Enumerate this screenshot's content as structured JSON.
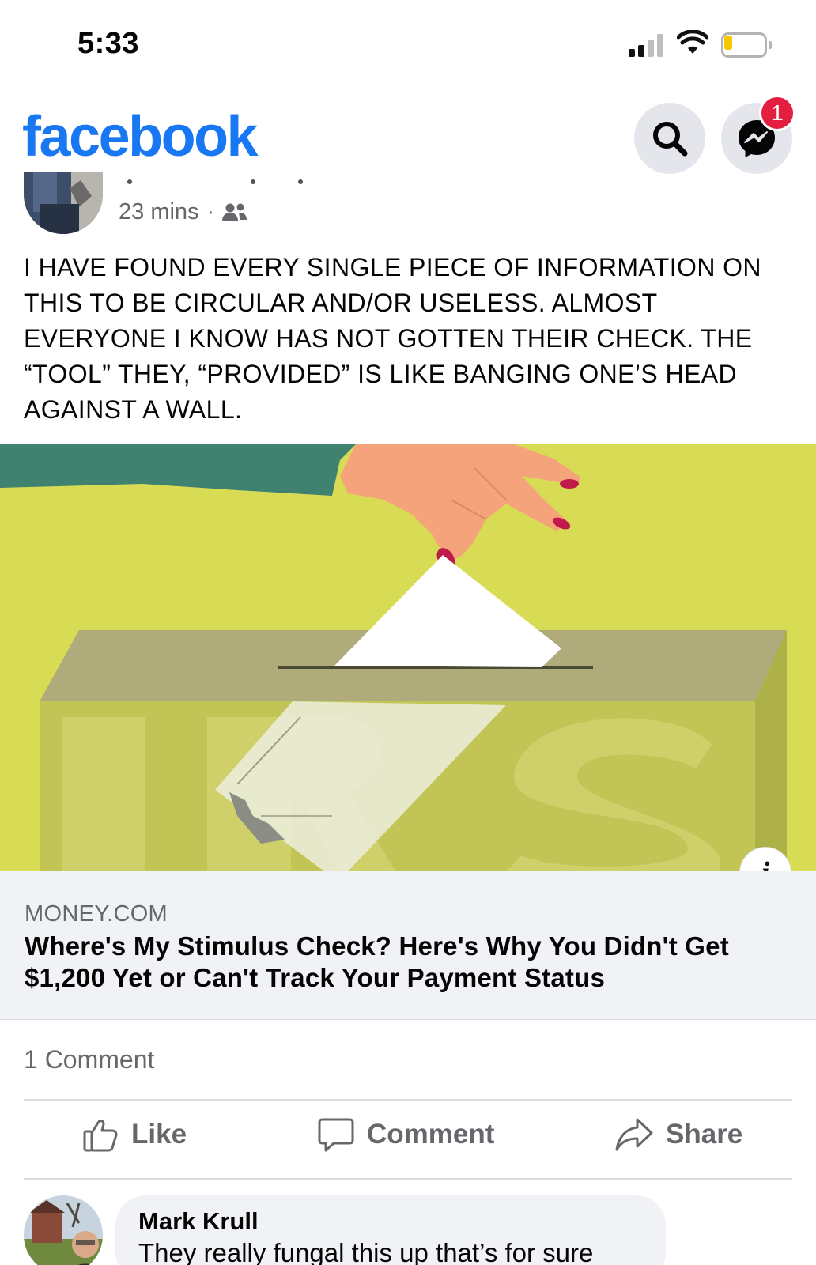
{
  "status_bar": {
    "time": "5:33",
    "icons": [
      "cellular-signal-icon",
      "wifi-icon",
      "battery-low-icon"
    ]
  },
  "header": {
    "logo": "facebook",
    "search_icon": "search-icon",
    "messenger_icon": "messenger-icon",
    "messenger_badge": "1",
    "brand_color": "#1877f2",
    "badge_color": "#e41e3f"
  },
  "post": {
    "time": "23 mins",
    "separator": "·",
    "audience_icon": "friends-icon",
    "text": "I HAVE FOUND EVERY SINGLE PIECE OF INFORMATION ON THIS TO BE CIRCULAR AND/OR USELESS.  ALMOST EVERYONE I KNOW HAS NOT GOTTEN THEIR CHECK. THE “TOOL” THEY, “PROVIDED” IS LIKE BANGING ONE’S HEAD AGAINST A WALL."
  },
  "link_preview": {
    "image_text": "IRS",
    "info_label": "i",
    "domain": "MONEY.COM",
    "title": "Where's My Stimulus Check? Here's Why You Didn't Get $1,200 Yet or Can't Track Your Payment Status"
  },
  "engagement": {
    "comment_count": "1 Comment"
  },
  "actions": {
    "like": "Like",
    "comment": "Comment",
    "share": "Share"
  },
  "comment": {
    "author": "Mark Krull",
    "text": "They really fungal this up that’s for sure"
  }
}
